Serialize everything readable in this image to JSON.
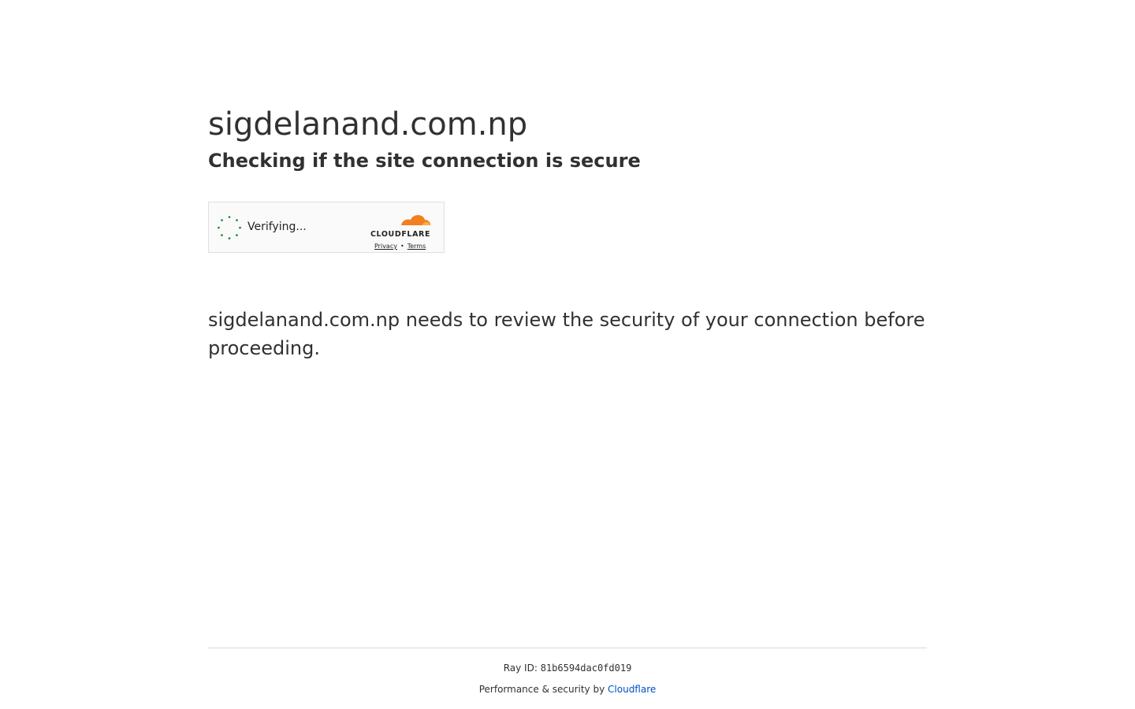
{
  "page": {
    "site": "sigdelanand.com.np",
    "subtitle": "Checking if the site connection is secure",
    "message": "sigdelanand.com.np needs to review the security of your connection before proceeding."
  },
  "widget": {
    "status": "Verifying...",
    "brand": "CLOUDFLARE",
    "privacy_label": "Privacy",
    "terms_label": "Terms",
    "separator": "•",
    "spinner_icon": "loading-spinner-icon",
    "logo_icon": "cloudflare-logo-icon",
    "spinner_color": "#038127",
    "cloud_color": "#f38020",
    "cloud_light_color": "#faae40"
  },
  "footer": {
    "ray_label": "Ray ID:",
    "ray_id": "81b6594dac0fd019",
    "perf_label": "Performance & security by",
    "perf_link": "Cloudflare",
    "link_color": "#0051c3"
  }
}
